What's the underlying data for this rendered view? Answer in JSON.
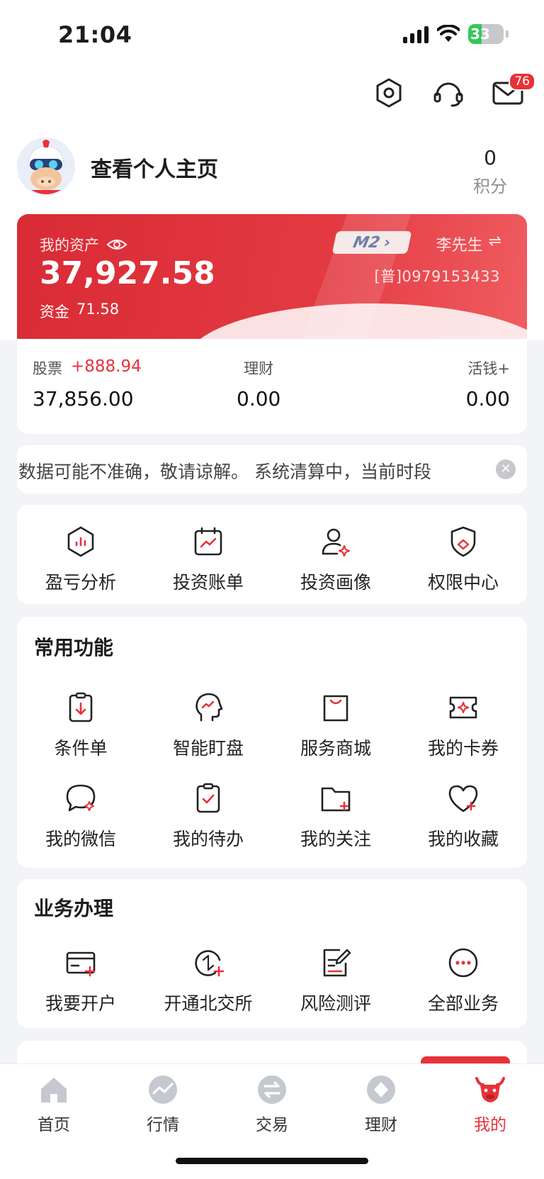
{
  "status_bar": {
    "time": "21:04",
    "battery": "33"
  },
  "header": {
    "mail_badge": "76"
  },
  "profile": {
    "link_label": "查看个人主页",
    "points_value": "0",
    "points_label": "积分"
  },
  "asset_card": {
    "title": "我的资产",
    "total": "37,927.58",
    "cash_label": "资金",
    "cash_value": "71.58",
    "level": "M2",
    "account_name": "李先生",
    "switch_glyph": "⇌",
    "account_no": "[普]0979153433"
  },
  "holdings": {
    "stock_label": "股票",
    "stock_change": "+888.94",
    "stock_value": "37,856.00",
    "wealth_label": "理财",
    "wealth_value": "0.00",
    "cash_plus_label": "活钱+",
    "cash_plus_value": "0.00"
  },
  "ticker": {
    "text": "数据可能不准确，敬请谅解。    系统清算中，当前时段"
  },
  "quick_tools": [
    {
      "label": "盈亏分析",
      "icon": "hexagon-chart-icon"
    },
    {
      "label": "投资账单",
      "icon": "calendar-trend-icon"
    },
    {
      "label": "投资画像",
      "icon": "user-sparkle-icon"
    },
    {
      "label": "权限中心",
      "icon": "shield-diamond-icon"
    }
  ],
  "common": {
    "title": "常用功能",
    "items": [
      {
        "label": "条件单",
        "icon": "clipboard-download-icon"
      },
      {
        "label": "智能盯盘",
        "icon": "head-trend-icon"
      },
      {
        "label": "服务商城",
        "icon": "shopping-bag-icon"
      },
      {
        "label": "我的卡券",
        "icon": "ticket-icon"
      },
      {
        "label": "我的微信",
        "icon": "chat-bubble-icon"
      },
      {
        "label": "我的待办",
        "icon": "clipboard-check-icon"
      },
      {
        "label": "我的关注",
        "icon": "folder-plus-icon"
      },
      {
        "label": "我的收藏",
        "icon": "heart-plus-icon"
      }
    ]
  },
  "business": {
    "title": "业务办理",
    "items": [
      {
        "label": "我要开户",
        "icon": "card-plus-icon"
      },
      {
        "label": "开通北交所",
        "icon": "exchange-plus-icon"
      },
      {
        "label": "风险测评",
        "icon": "document-edit-icon"
      },
      {
        "label": "全部业务",
        "icon": "more-circle-icon"
      }
    ]
  },
  "tabs": [
    {
      "label": "首页",
      "icon": "home-icon"
    },
    {
      "label": "行情",
      "icon": "market-icon"
    },
    {
      "label": "交易",
      "icon": "trade-icon"
    },
    {
      "label": "理财",
      "icon": "wealth-icon"
    },
    {
      "label": "我的",
      "icon": "bull-icon"
    }
  ],
  "colors": {
    "brand_red": "#e8313a",
    "icon_gray": "#222222",
    "inactive_tab": "#c5c8cf"
  }
}
